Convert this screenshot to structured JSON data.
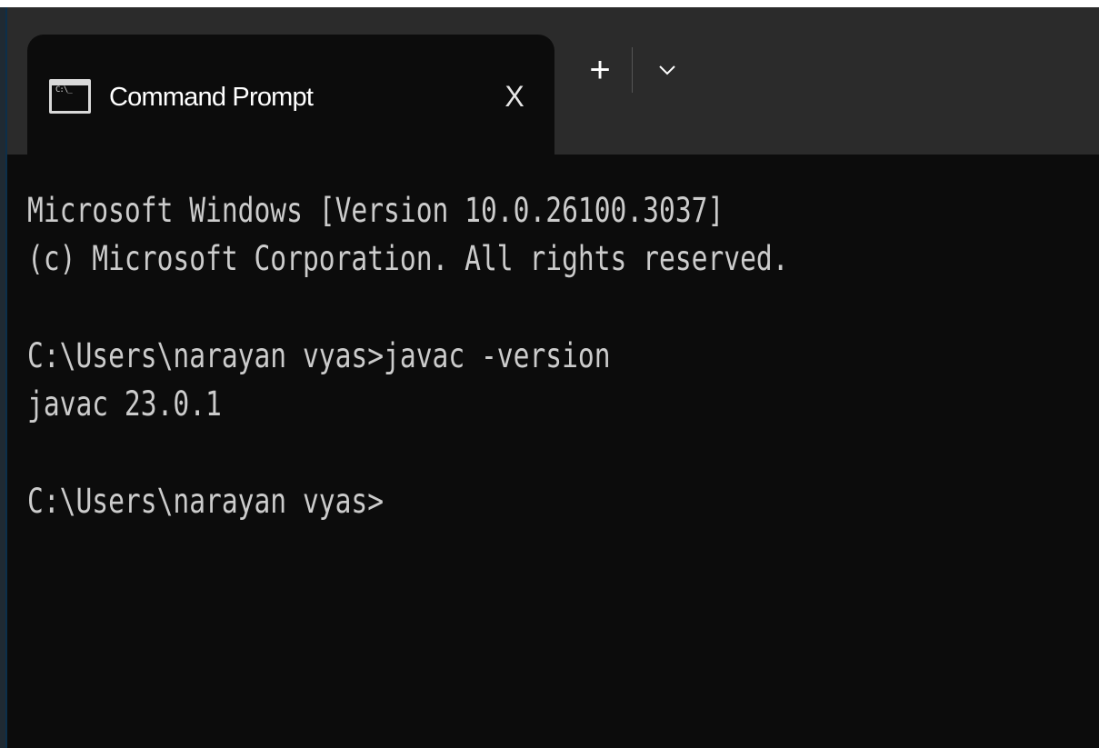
{
  "tab": {
    "title": "Command Prompt",
    "close_label": "X",
    "icon": "cmd-icon",
    "icon_glyph": "C:\\_"
  },
  "tabbar": {
    "new_tab_label": "+",
    "dropdown_icon": "chevron-down-icon"
  },
  "terminal": {
    "lines": [
      "Microsoft Windows [Version 10.0.26100.3037]",
      "(c) Microsoft Corporation. All rights reserved.",
      "",
      "C:\\Users\\narayan vyas>javac -version",
      "javac 23.0.1",
      "",
      "C:\\Users\\narayan vyas>"
    ]
  },
  "colors": {
    "terminal_background": "#0c0c0c",
    "tabbar_background": "#2b2b2b",
    "terminal_text": "#cccccc",
    "tab_text": "#ffffff"
  }
}
